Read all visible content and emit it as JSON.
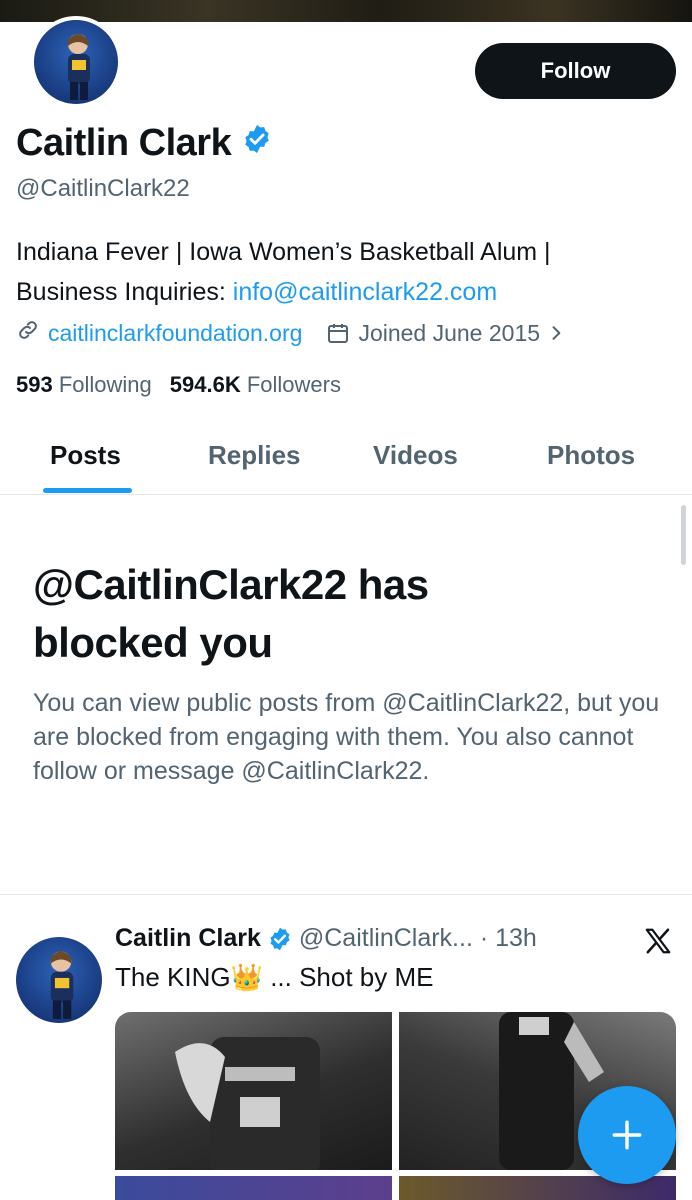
{
  "profile": {
    "name": "Caitlin Clark",
    "handle": "@CaitlinClark22",
    "follow_label": "Follow",
    "bio_line1": "Indiana Fever | Iowa Women’s Basketball Alum |",
    "bio_line2_prefix": "Business Inquiries: ",
    "bio_email": "info@caitlinclark22.com",
    "website": "caitlinclarkfoundation.org",
    "joined": "Joined June 2015",
    "following_count": "593",
    "following_label": "Following",
    "followers_count": "594.6K",
    "followers_label": "Followers"
  },
  "tabs": [
    {
      "label": "Posts",
      "active": true
    },
    {
      "label": "Replies"
    },
    {
      "label": "Videos"
    },
    {
      "label": "Photos"
    }
  ],
  "blocked": {
    "title_line1": "@CaitlinClark22 has",
    "title_line2": "blocked you",
    "body": "You can view public posts from @CaitlinClark22, but you are blocked from engaging with them. You also cannot follow or message @CaitlinClark22."
  },
  "post": {
    "name": "Caitlin Clark",
    "handle_time": "@CaitlinClark... · 13h",
    "text": "The KING👑 ... Shot by ME"
  },
  "colors": {
    "accent": "#1d9bf0",
    "text_primary": "#0f1419",
    "text_secondary": "#536471"
  },
  "icons": [
    "verified-badge-icon",
    "link-icon",
    "calendar-icon",
    "chevron-right-icon",
    "x-logo-icon",
    "plus-icon"
  ]
}
